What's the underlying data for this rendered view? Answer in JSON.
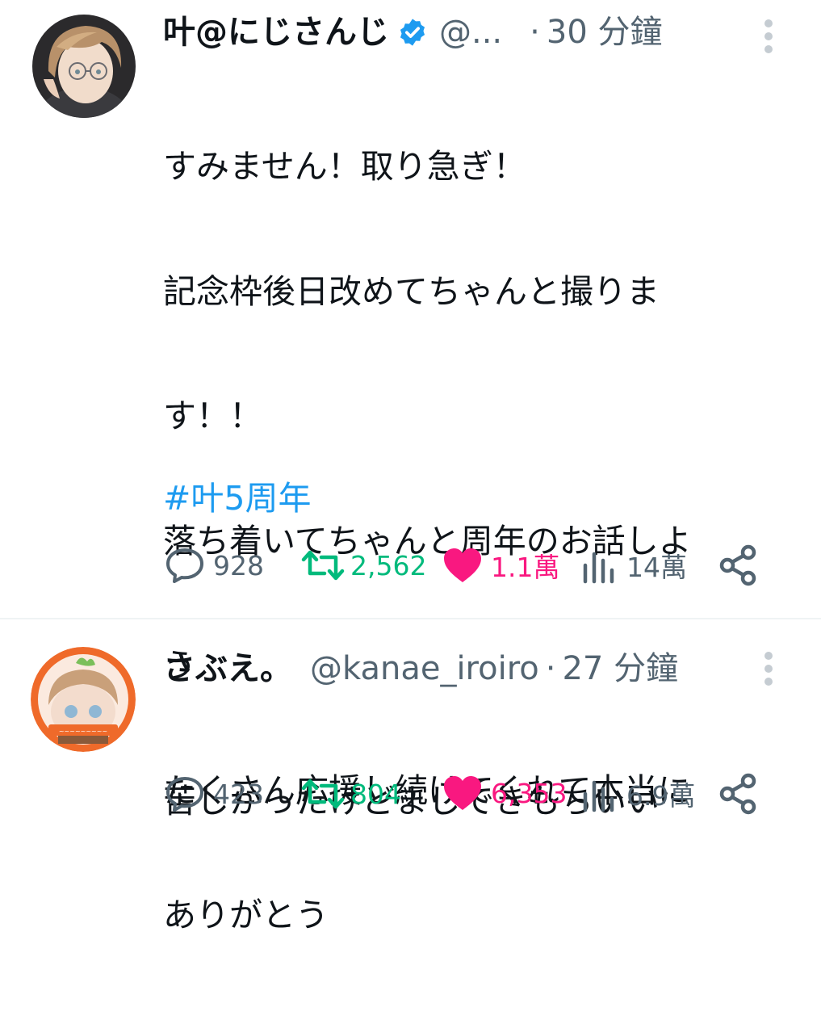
{
  "tweets": [
    {
      "name": "叶@にじさんじ",
      "verified": true,
      "handle": "@...",
      "separator": "·",
      "time": "30 分鐘",
      "lines": [
        "すみません！取り急ぎ！",
        "記念枠後日改めてちゃんと撮りま",
        "す！！",
        "落ち着いてちゃんと周年のお話しよ",
        "う",
        "たくさん応援し続けてくれて本当に",
        "ありがとう"
      ],
      "hashtag": "#叶5周年",
      "replies": "928",
      "retweets": "2,562",
      "likes": "1.1萬",
      "views": "14萬",
      "liked": true
    },
    {
      "name": "さぶえ。",
      "verified": false,
      "handle": "@kanae_iroiro",
      "separator": "·",
      "time": "27 分鐘",
      "lines": [
        "苦しかったけどまじできもちいい"
      ],
      "replies": "423",
      "retweets": "804",
      "likes": "6,353",
      "views": "6.9萬",
      "liked": true
    }
  ],
  "colors": {
    "text": "#0f1419",
    "secondary": "#536471",
    "link": "#1d9bf0",
    "retweet": "#00ba7c",
    "like": "#f91880"
  },
  "icons": {
    "reply": "speech-bubble-icon",
    "retweet": "retweet-arrows-icon",
    "like": "heart-icon",
    "views": "bar-chart-icon",
    "share": "share-icon",
    "verified": "verified-badge-icon",
    "more": "more-vertical-icon"
  }
}
